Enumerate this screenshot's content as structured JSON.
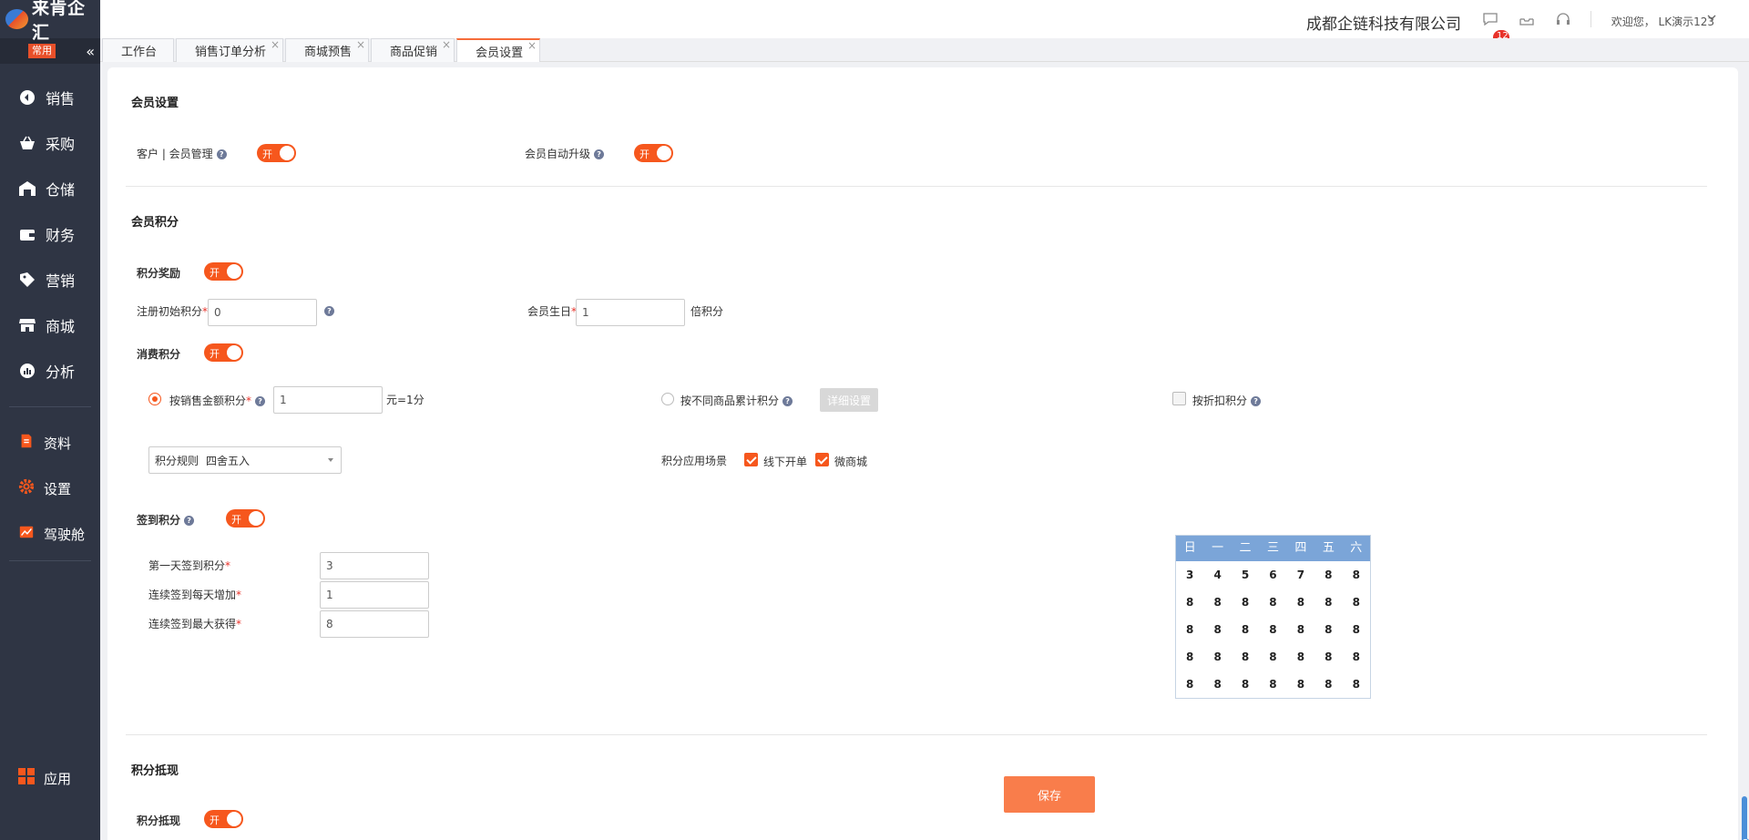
{
  "app": {
    "logo_text": "来肯企汇",
    "favorites_label": "常用",
    "collapse_label": "«"
  },
  "sidebar": {
    "items": [
      {
        "label": "销售",
        "icon": "sales-icon"
      },
      {
        "label": "采购",
        "icon": "basket-icon"
      },
      {
        "label": "仓储",
        "icon": "warehouse-icon"
      },
      {
        "label": "财务",
        "icon": "wallet-icon"
      },
      {
        "label": "营销",
        "icon": "tag-icon"
      },
      {
        "label": "商城",
        "icon": "store-icon"
      },
      {
        "label": "分析",
        "icon": "analysis-icon"
      }
    ],
    "secondary": [
      {
        "label": "资料",
        "icon": "document-icon"
      },
      {
        "label": "设置",
        "icon": "gear-icon"
      },
      {
        "label": "驾驶舱",
        "icon": "dashboard-chart-icon"
      }
    ],
    "apps_label": "应用"
  },
  "header": {
    "company": "成都企链科技有限公司",
    "message_count": "121",
    "welcome": "欢迎您，  LK演示123"
  },
  "tabs": [
    {
      "label": "工作台",
      "closable": false,
      "active": false
    },
    {
      "label": "销售订单分析",
      "closable": true,
      "active": false
    },
    {
      "label": "商城预售",
      "closable": true,
      "active": false
    },
    {
      "label": "商品促销",
      "closable": true,
      "active": false
    },
    {
      "label": "会员设置",
      "closable": true,
      "active": true
    }
  ],
  "member_settings": {
    "title": "会员设置",
    "customer_member_label": "客户 | 会员管理",
    "auto_upgrade_label": "会员自动升级",
    "toggle_on": "开"
  },
  "points": {
    "title": "会员积分",
    "reward_label": "积分奖励",
    "register_label": "注册初始积分",
    "register_value": "0",
    "birthday_label": "会员生日",
    "birthday_value": "1",
    "birthday_unit": "倍积分",
    "consume_label": "消费积分",
    "by_amount_label": "按销售金额积分",
    "by_amount_value": "1",
    "by_amount_unit": "元=1分",
    "by_product_label": "按不同商品累计积分",
    "detail_button": "详细设置",
    "by_discount_label": "按折扣积分",
    "rule_label": "积分规则",
    "rule_value": "四舍五入",
    "scene_label": "积分应用场景",
    "scene_offline": "线下开单",
    "scene_wechat": "微商城",
    "checkin_label": "签到积分",
    "first_day_label": "第一天签到积分",
    "first_day_value": "3",
    "daily_increase_label": "连续签到每天增加",
    "daily_increase_value": "1",
    "max_label": "连续签到最大获得",
    "max_value": "8"
  },
  "calendar": {
    "headers": [
      "日",
      "一",
      "二",
      "三",
      "四",
      "五",
      "六"
    ],
    "rows": [
      [
        "3",
        "4",
        "5",
        "6",
        "7",
        "8",
        "8"
      ],
      [
        "8",
        "8",
        "8",
        "8",
        "8",
        "8",
        "8"
      ],
      [
        "8",
        "8",
        "8",
        "8",
        "8",
        "8",
        "8"
      ],
      [
        "8",
        "8",
        "8",
        "8",
        "8",
        "8",
        "8"
      ],
      [
        "8",
        "8",
        "8",
        "8",
        "8",
        "8",
        "8"
      ]
    ]
  },
  "redeem": {
    "title": "积分抵现",
    "label": "积分抵现"
  },
  "save_label": "保存",
  "colors": {
    "accent": "#f6571d",
    "save": "#f97d4b",
    "sidebar": "#2f3544",
    "calendar_header": "#7ba5d8"
  }
}
